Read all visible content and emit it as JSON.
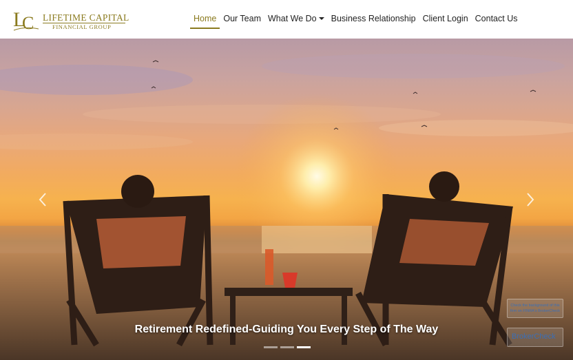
{
  "logo": {
    "monogram": "LC",
    "title": "LIFETIME CAPITAL",
    "subtitle": "FINANCIAL GROUP"
  },
  "nav": {
    "items": [
      {
        "label": "Home",
        "active": true
      },
      {
        "label": "Our Team"
      },
      {
        "label": "What We Do",
        "dropdown": true
      },
      {
        "label": "Business Relationship"
      },
      {
        "label": "Client Login"
      },
      {
        "label": "Contact Us"
      }
    ]
  },
  "hero": {
    "caption": "Retirement Redefined-Guiding You Every Step of The Way",
    "slides_total": 3,
    "active_slide": 3
  },
  "badges": {
    "check_label": "Check the background of this firm on FINRA's BrokerCheck",
    "brokercheck_label": "BrokerCheck"
  },
  "colors": {
    "brand_gold": "#8a7a1e"
  }
}
